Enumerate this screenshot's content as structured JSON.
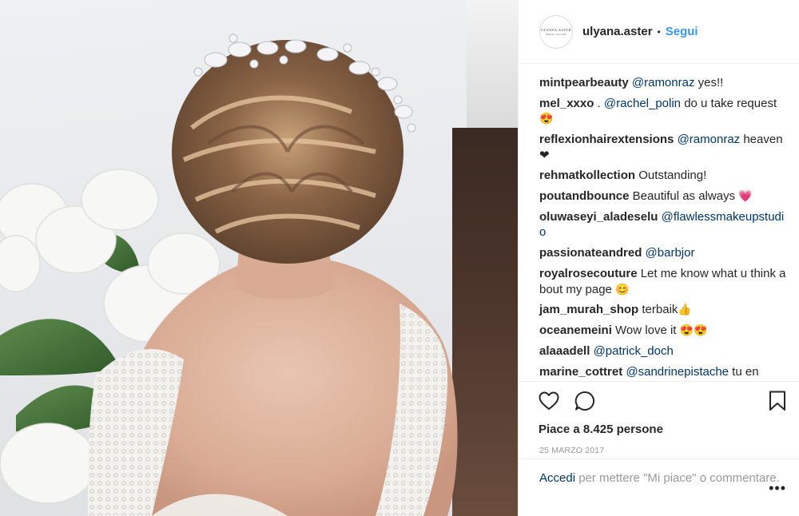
{
  "header": {
    "avatar_line1": "ULYANA ASTER",
    "avatar_line2": "BRIDAL COUTURE",
    "username": "ulyana.aster",
    "separator": "•",
    "follow_label": "Segui"
  },
  "photo": {
    "alt": "Bride with braided updo hairstyle and floral hair accessory"
  },
  "comments": [
    {
      "user": "mintpearbeauty",
      "mention": "@ramonraz",
      "text": " yes!!"
    },
    {
      "user": "mel_xxxo",
      "text": " . ",
      "mention": "@rachel_polin",
      "text2": " do u take request ",
      "emoji": "😍"
    },
    {
      "user": "reflexionhairextensions",
      "mention": "@ramonraz",
      "text": " heaven ❤"
    },
    {
      "user": "rehmatkollection",
      "text": " Outstanding!"
    },
    {
      "user": "poutandbounce",
      "text": " Beautiful as always ",
      "emoji": "💗"
    },
    {
      "user": "oluwaseyi_aladeselu",
      "mention": "@flawlessmakeupstudio"
    },
    {
      "user": "passionateandred",
      "mention": "@barbjor"
    },
    {
      "user": "royalrosecouture",
      "text": " Let me know what u think about my page ",
      "emoji": "😊"
    },
    {
      "user": "jam_murah_shop",
      "text": " terbaik",
      "emoji": "👍"
    },
    {
      "user": "oceanemeini",
      "text": " Wow love it ",
      "emoji": "😍😍"
    },
    {
      "user": "alaaadell",
      "mention": "@patrick_doch"
    },
    {
      "user": "marine_cottret",
      "mention": "@sandrinepistache",
      "text": " tu en"
    }
  ],
  "actions": {
    "like_icon": "heart-icon",
    "comment_icon": "comment-bubble-icon",
    "save_icon": "bookmark-icon"
  },
  "likes_text": "Piace a 8.425 persone",
  "date_text": "25 MARZO 2017",
  "login": {
    "link": "Accedi",
    "text": " per mettere \"Mi piace\" o commentare.",
    "more": "•••"
  }
}
